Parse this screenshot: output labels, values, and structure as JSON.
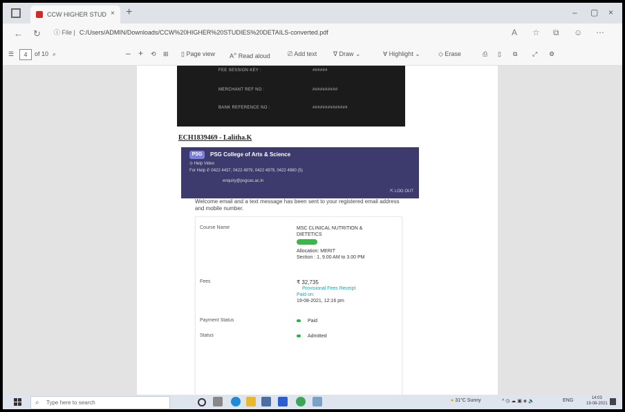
{
  "browser": {
    "tab_title": "CCW HIGHER STUDIES DETAILS",
    "tab_close": "×",
    "new_tab": "+",
    "address_info": "ⓘ File |",
    "address_url": "C:/Users/ADMIN/Downloads/CCW%20HIGHER%20STUDIES%20DETAILS-converted.pdf",
    "win_minimize": "–",
    "win_maximize": "▢",
    "win_close": "×"
  },
  "pdf_toolbar": {
    "page_current": "4",
    "page_total": "of 10",
    "zoom_out": "–",
    "zoom_in": "+",
    "page_view": "Page view",
    "read_aloud": "Read aloud",
    "add_text": "Add text",
    "draw": "Draw",
    "highlight": "Highlight",
    "erase": "Erase"
  },
  "document": {
    "dark_rows": [
      "FEE SESSION KEY :",
      "MERCHANT REF NO :",
      "BANK REFERENCE NO :"
    ],
    "dark_values": [
      "######",
      "##########",
      "##############"
    ],
    "student_id": "ECH1839469 - Lalitha.K",
    "college_name": "PSG College of Arts & Science",
    "help_video": "Help Video",
    "for_help": "For Help  ✆ 0422 4437, 0422 4979, 0422 4979, 0422 4980 (5)",
    "email": "enquiry@psgcas.ac.in",
    "logout": "LOG OUT",
    "welcome": "Welcome email and a text message has been sent to your registered email address and mobile number.",
    "course_label": "Course Name",
    "course_value": "MSC CLINICAL NUTRITION & DIETETICS",
    "allocation": "Allocation: MERIT",
    "section": "Section : 1, 9.00 AM to 3.00 PM",
    "fees_label": "Fees",
    "fees_value": "₹ 32,735",
    "receipt": "Provisional Fees Receipt",
    "paid_on": "Paid on:",
    "paid_date": "19-08-2021, 12:16 pm",
    "payment_label": "Payment Status",
    "payment_value": "Paid",
    "status_label": "Status",
    "status_value": "Admitted"
  },
  "taskbar": {
    "search_placeholder": "Type here to search",
    "weather": "31°C Sunny",
    "lang": "ENG",
    "time": "14:03",
    "date": "19-08-2021"
  },
  "colors": {
    "banner": "#3d3a6e",
    "badge_green": "#3cb54a",
    "pdf_red": "#d02a2a"
  }
}
